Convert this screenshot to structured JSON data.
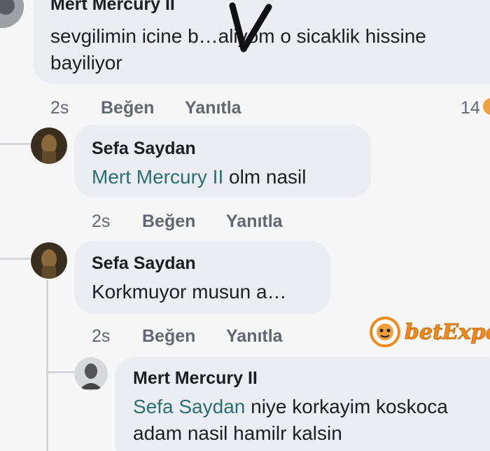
{
  "comments": [
    {
      "author": "Mert Mercury II",
      "line1": "sevgilimin icine b…aliyom o sicaklik hissine",
      "line2": "bayiliyor",
      "time": "2s",
      "like": "Beğen",
      "reply": "Yanıtla",
      "reaction_count": "14"
    },
    {
      "author": "Sefa Saydan",
      "mention": "Mert Mercury II",
      "text": " olm nasil",
      "time": "2s",
      "like": "Beğen",
      "reply": "Yanıtla"
    },
    {
      "author": "Sefa Saydan",
      "text": "Korkmuyor musun a…",
      "time": "2s",
      "like": "Beğen",
      "reply": "Yanıtla"
    },
    {
      "author": "Mert Mercury II",
      "mention": "Sefa Saydan",
      "line1": " niye korkayim koskoca",
      "line2": "adam nasil hamilr kalsin"
    }
  ],
  "watermark": {
    "brand": "betExper",
    "logo_icon": "tiger-badge-icon"
  },
  "colors": {
    "bubble": "#ebedf2",
    "mention": "#2a6f73",
    "meta": "#606770",
    "watermark_orange": "#f08a1c"
  }
}
